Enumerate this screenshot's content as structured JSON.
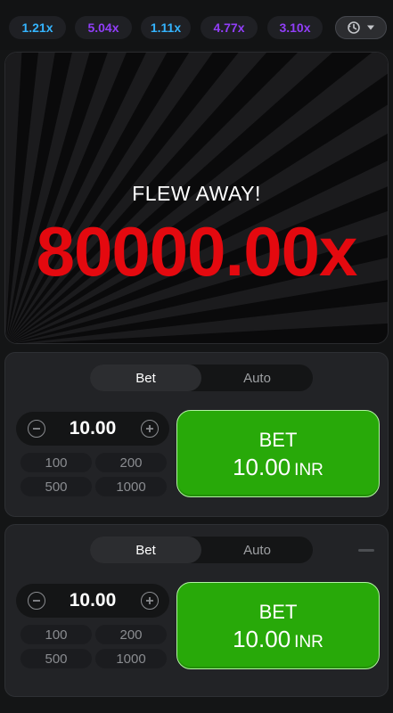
{
  "history": {
    "multipliers": [
      {
        "value": "1.21x",
        "color": "#34b4ff"
      },
      {
        "value": "5.04x",
        "color": "#913ef8"
      },
      {
        "value": "1.11x",
        "color": "#34b4ff"
      },
      {
        "value": "4.77x",
        "color": "#913ef8"
      },
      {
        "value": "3.10x",
        "color": "#913ef8"
      }
    ],
    "history_icon": "history-clock-icon",
    "dropdown_icon": "caret-down-icon"
  },
  "game": {
    "status": "FLEW AWAY!",
    "multiplier": "80000.00x",
    "multiplier_color": "#e4090f"
  },
  "panels": [
    {
      "tabs": {
        "bet": "Bet",
        "auto": "Auto"
      },
      "amount": "10.00",
      "quick": [
        "100",
        "200",
        "500",
        "1000"
      ],
      "bet_button": {
        "line1": "BET",
        "amount": "10.00",
        "currency": "INR"
      }
    },
    {
      "tabs": {
        "bet": "Bet",
        "auto": "Auto"
      },
      "amount": "10.00",
      "quick": [
        "100",
        "200",
        "500",
        "1000"
      ],
      "bet_button": {
        "line1": "BET",
        "amount": "10.00",
        "currency": "INR"
      }
    }
  ],
  "colors": {
    "bet_green": "#28a909",
    "accent_blue": "#34b4ff",
    "accent_purple": "#913ef8"
  }
}
